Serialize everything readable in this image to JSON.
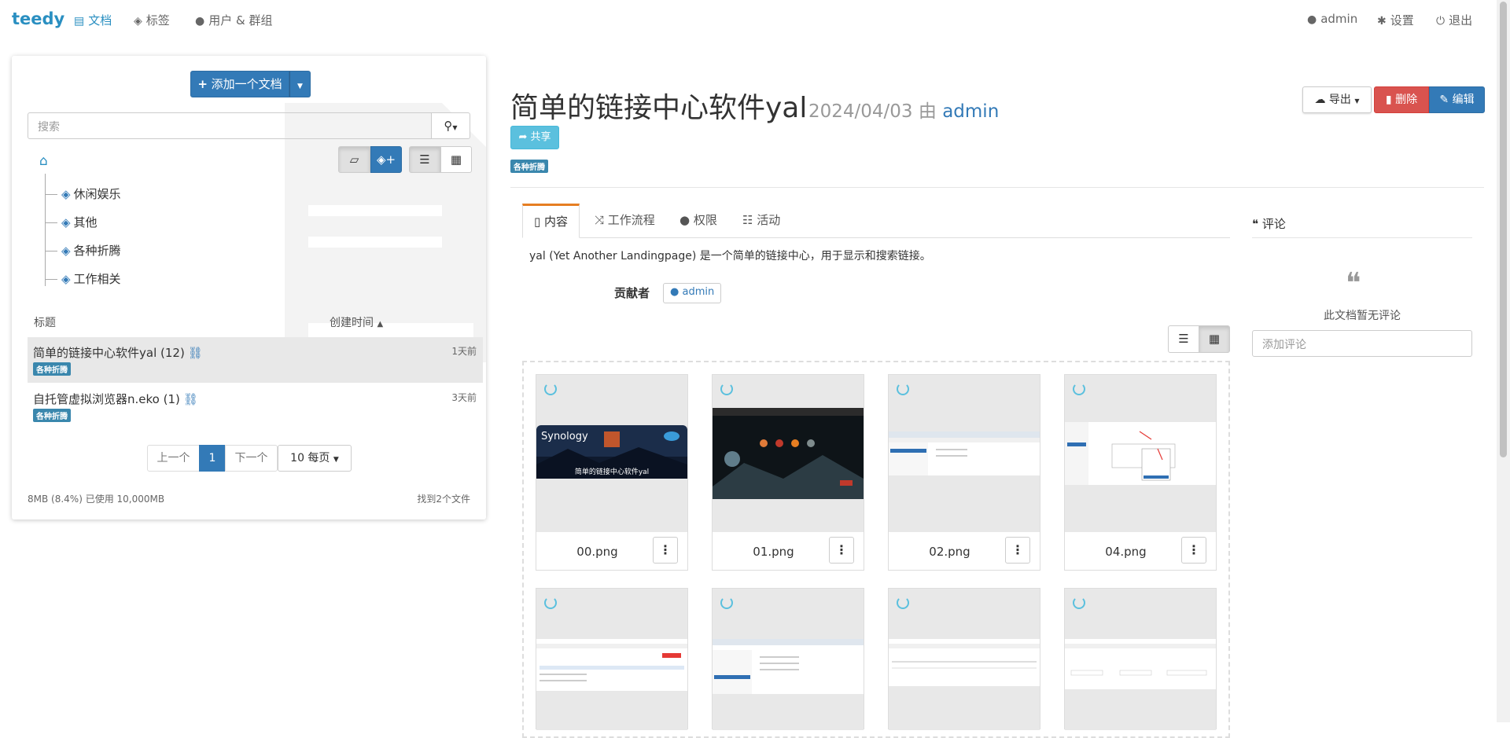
{
  "nav": {
    "brand": "teedy",
    "documents": "文档",
    "tags": "标签",
    "users_groups": "用户 & 群组",
    "user": "admin",
    "settings": "设置",
    "logout": "退出"
  },
  "left": {
    "add_document": "添加一个文档",
    "search_placeholder": "搜索",
    "tree": [
      "休闲娱乐",
      "其他",
      "各种折腾",
      "工作相关"
    ],
    "columns": {
      "title": "标题",
      "created": "创建时间"
    },
    "documents": [
      {
        "title": "简单的链接中心软件yal (12)",
        "time": "1天前",
        "tag": "各种折腾"
      },
      {
        "title": "自托管虚拟浏览器n.eko (1)",
        "time": "3天前",
        "tag": "各种折腾"
      }
    ],
    "pagination": {
      "prev": "上一个",
      "current": "1",
      "next": "下一个",
      "per_page": "10 每页"
    },
    "quota": "8MB (8.4%) 已使用 10,000MB",
    "found": "找到2个文件"
  },
  "document": {
    "title": "简单的链接中心软件yal",
    "date": "2024/04/03",
    "by": "由",
    "author": "admin",
    "share": "共享",
    "tag": "各种折腾",
    "export": "导出",
    "delete": "删除",
    "edit": "编辑",
    "tabs": [
      "内容",
      "工作流程",
      "权限",
      "活动"
    ],
    "description": "yal (Yet Another Landingpage) 是一个简单的链接中心，用于显示和搜索链接。",
    "contributors_label": "贡献者",
    "contributor": "admin",
    "files": [
      "00.png",
      "01.png",
      "02.png",
      "04.png"
    ],
    "synology_caption": "简单的链接中心软件yal"
  },
  "comments": {
    "title": "评论",
    "empty": "此文档暂无评论",
    "placeholder": "添加评论"
  },
  "colors": {
    "brand": "#2a8fc1",
    "primary": "#337ab7",
    "danger": "#d9534f",
    "info": "#5bc0de",
    "tag": "#3a87ad",
    "tab_accent": "#e67e22"
  }
}
